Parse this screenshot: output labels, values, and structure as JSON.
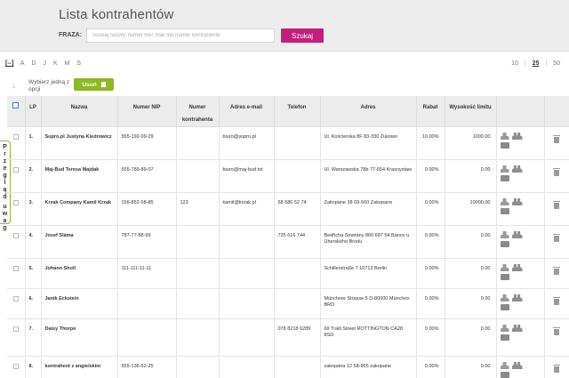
{
  "page": {
    "title": "Lista kontrahentów"
  },
  "search": {
    "label": "FRAZA:",
    "placeholder": "Szukaj nazwy, numer NIP, mail lub numer kontrahenta",
    "button_label": "Szukaj"
  },
  "alphabet": {
    "all_label": "[--]",
    "letters": [
      "A",
      "D",
      "J",
      "K",
      "M",
      "S"
    ]
  },
  "per_page": {
    "options": [
      "10",
      "25",
      "50"
    ],
    "selected": "25"
  },
  "bulk": {
    "hint": "Wybierz jedną z opcji",
    "remove_label": "Usuń"
  },
  "notes_tab": {
    "label": "Przegląd uwag",
    "letters": [
      "P",
      "r",
      "z",
      "e",
      "g",
      "l",
      "ą",
      "d",
      "",
      "u",
      "w",
      "a",
      "g"
    ]
  },
  "table": {
    "columns": [
      "LP",
      "Nazwa",
      "Numer NIP",
      "Numer kontrahenta",
      "Adres e-mail",
      "Telefon",
      "Adres",
      "Rabat",
      "Wysokość limitu"
    ],
    "rows": [
      {
        "lp": "1.",
        "name": "Supro.pl Justyna Kiedrowicz",
        "nip": "555-192-99-29",
        "number": "",
        "email": "biuro@supro.pl",
        "phone": "",
        "address": "Ul. Kościerska 8F 83-330 Żukowo",
        "discount": "10.00%",
        "limit": "1000.00"
      },
      {
        "lp": "2.",
        "name": "Maj-Bud Teresa Majdak",
        "nip": "555-789-89-07",
        "number": "",
        "email": "biuro@maj-bud.txt",
        "phone": "",
        "address": "Ul. Warszawska 78b 77-654 Krasnystaw",
        "discount": "0.00%",
        "limit": "0.00"
      },
      {
        "lp": "3.",
        "name": "Krzak Company Kamil Krzak",
        "nip": "156-852-58-85",
        "number": "123",
        "email": "kamil@krzak.pl",
        "phone": "58 580 52 74",
        "address": "Zakopane 38 09-560 Zakopane",
        "discount": "0.00%",
        "limit": "10000.00"
      },
      {
        "lp": "4.",
        "name": "Josef Sláma",
        "nip": "787-77-88-99",
        "number": "",
        "email": "",
        "phone": "735 616 744",
        "address": "Bedřicha Smetany 860 687 54 Bánov u Uherského Brodu",
        "discount": "0.00%",
        "limit": "0.00"
      },
      {
        "lp": "5.",
        "name": "Johann Sholl",
        "nip": "111-111-11-11",
        "number": "",
        "email": "",
        "phone": "",
        "address": "Schillerstraße 7 10713 Berlin",
        "discount": "0.00%",
        "limit": "0.00"
      },
      {
        "lp": "6.",
        "name": "Janik Eckstein",
        "nip": "",
        "number": "",
        "email": "",
        "phone": "",
        "address": "Münchner Strasse 5 D-80000 München BRD",
        "discount": "0.00%",
        "limit": "0.00"
      },
      {
        "lp": "7.",
        "name": "Daisy Thorpe",
        "nip": "",
        "number": "",
        "email": "",
        "phone": "078 8218 6289",
        "address": "69 Traill Street ROTTINGTON CA28 8SD",
        "discount": "0.00%",
        "limit": "0.00"
      },
      {
        "lp": "8.",
        "name": "kontrahent z angielskim",
        "nip": "555-136-62-25",
        "number": "",
        "email": "",
        "phone": "",
        "address": "zakopana 12 58-965 zakopane",
        "discount": "0.00%",
        "limit": "0.00"
      }
    ]
  }
}
